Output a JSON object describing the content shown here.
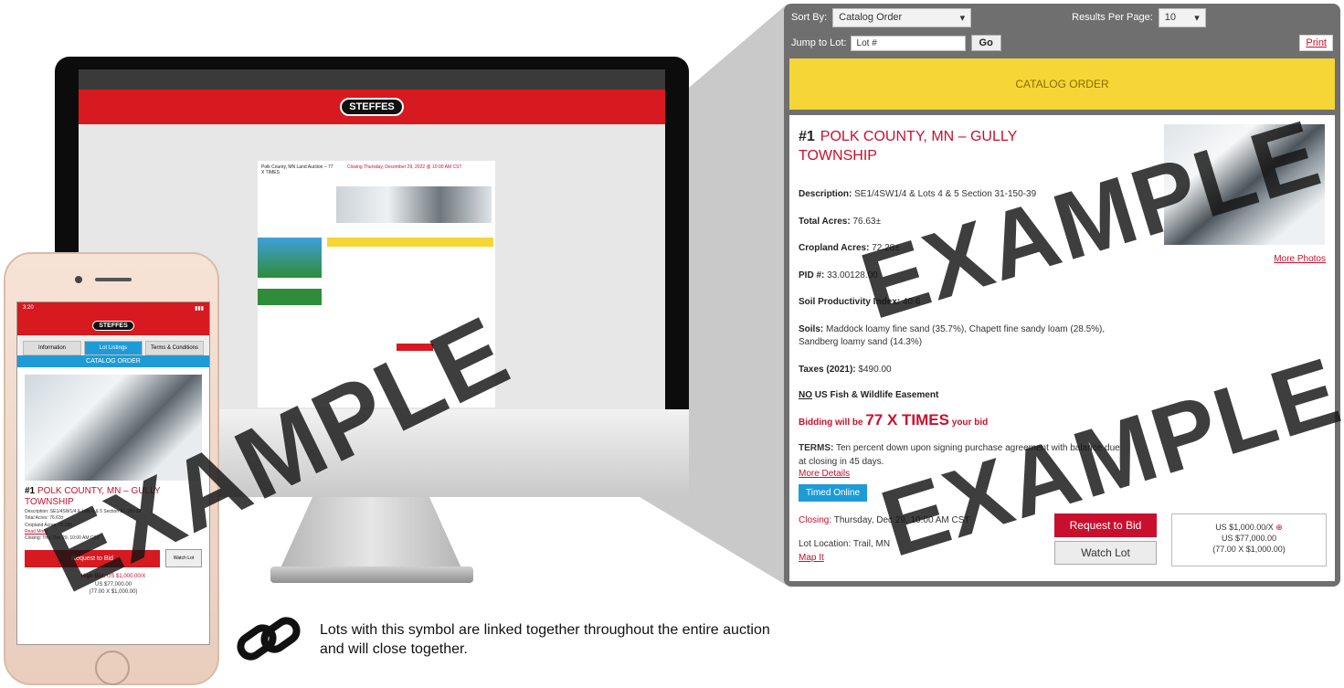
{
  "brand": {
    "logo_text": "STEFFES",
    "accent": "#d71920",
    "link_red": "#c8102e",
    "info_blue": "#1e9bd7",
    "banner_yellow": "#f6d536"
  },
  "watermark": "EXAMPLE",
  "desktop_preview": {
    "lot_heading": "Polk County, MN Land Auction – 77 X TIMES",
    "closing": "Closing Thursday, December 29, 2022 @ 10:00 AM CST"
  },
  "phone": {
    "time": "3:20",
    "tabs": [
      "Information",
      "Lot Listings",
      "Terms & Conditions"
    ],
    "catalog_label": "CATALOG ORDER",
    "lot_number": "#1",
    "lot_title": "POLK COUNTY, MN – GULLY TOWNSHIP",
    "details": [
      "Description: SE1/4SW1/4 & Lots 4 & 5 Section 31-150-39",
      "Total Acres: 76.63±",
      "Cropland Acres: 72.28±",
      "Read More",
      "Closing: Thu, Dec 29, 10:00 AM CST"
    ],
    "request_bid": "Request to Bid",
    "watch_lot": "Watch Lot",
    "high_bid_label": "High Bid:",
    "high_bid_value": "US $1,000.00/X",
    "total": "US $77,000.00",
    "calc": "(77.00 X $1,000.00)"
  },
  "panel": {
    "sort_by_label": "Sort By:",
    "sort_by_value": "Catalog Order",
    "results_label": "Results Per Page:",
    "results_value": "10",
    "jump_label": "Jump to Lot:",
    "jump_placeholder": "Lot #",
    "go_label": "Go",
    "print_label": "Print",
    "banner": "CATALOG ORDER",
    "lot_number": "#1",
    "lot_title": "POLK COUNTY, MN – GULLY TOWNSHIP",
    "more_photos": "More Photos",
    "facts": [
      {
        "label": "Description:",
        "value": " SE1/4SW1/4 & Lots 4 & 5 Section 31-150-39"
      },
      {
        "label": "Total Acres:",
        "value": " 76.63±"
      },
      {
        "label": "Cropland Acres:",
        "value": " 72.28±"
      },
      {
        "label": "PID #:",
        "value": " 33.00128.00"
      },
      {
        "label": "Soil Productivity Index:",
        "value": " 40.6"
      },
      {
        "label": "Soils:",
        "value": " Maddock loamy fine sand (35.7%), Chapett fine sandy loam (28.5%), Sandberg loamy sand (14.3%)"
      },
      {
        "label": "Taxes (2021):",
        "value": " $490.00"
      }
    ],
    "easement_no": "NO",
    "easement_rest": " US Fish & Wildlife Easement",
    "bid_prefix": "Bidding will be ",
    "bid_big": "77 X TIMES",
    "bid_suffix": " your bid",
    "terms_label": "TERMS:",
    "terms_text": " Ten percent down upon signing purchase agreement with balance due at closing in 45 days.",
    "more_details": "More Details",
    "timed_online": "Timed Online",
    "closing_label": "Closing:",
    "closing_value": " Thursday, Dec 29, 10:00 AM CST",
    "lot_location": "Lot Location: Trail, MN",
    "map_it": "Map It",
    "request_bid": "Request to Bid",
    "watch_lot": "Watch Lot",
    "high_bid": "US $1,000.00/X",
    "total": "US $77,000.00",
    "calc": "(77.00 X $1,000.00)"
  },
  "legend": {
    "icon": "chain-link-icon",
    "text": "Lots with this symbol are linked together throughout the entire auction and will close together."
  }
}
